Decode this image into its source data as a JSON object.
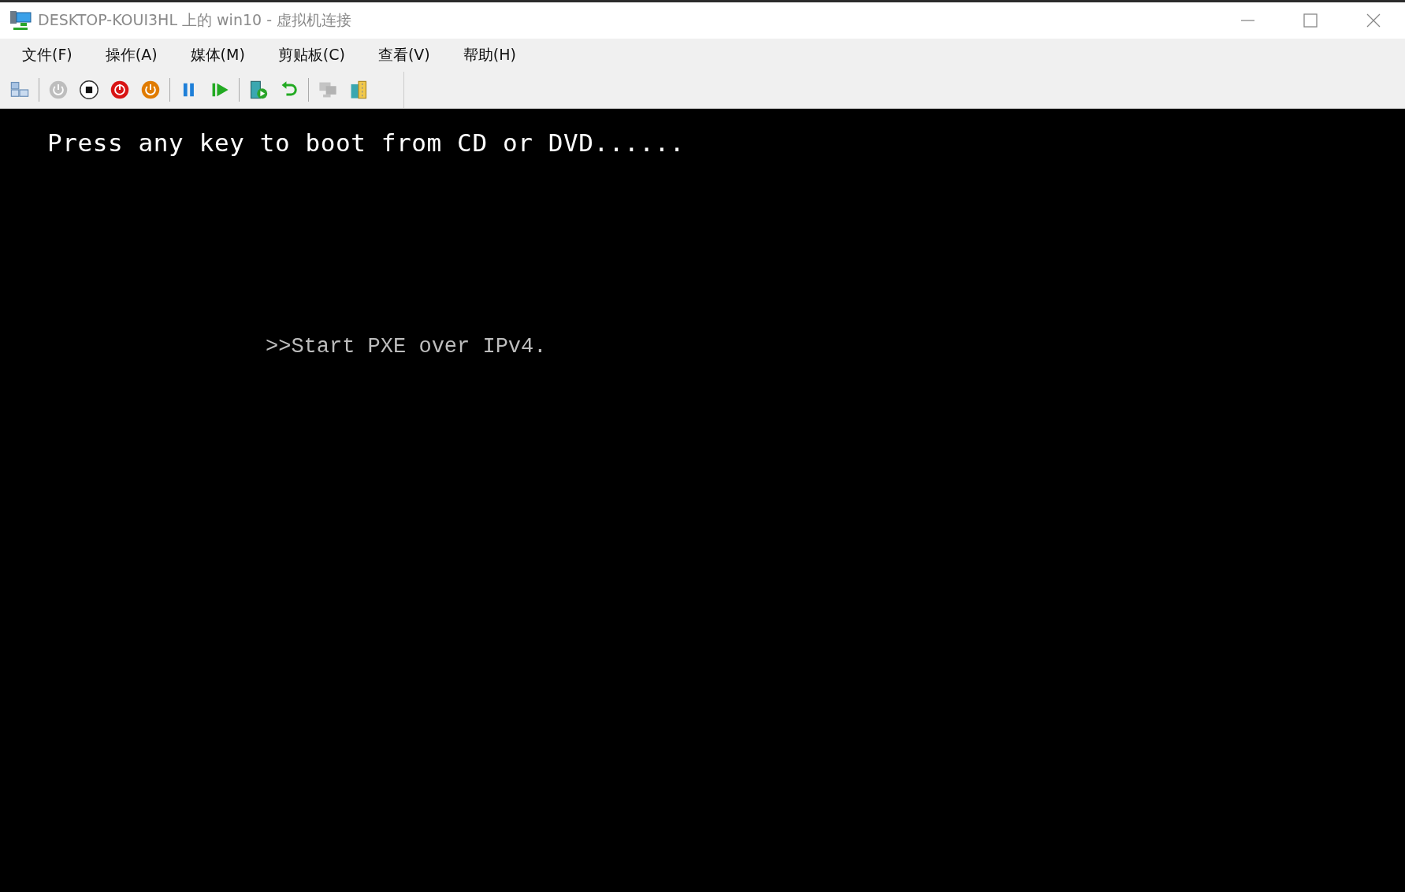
{
  "window": {
    "title": "DESKTOP-KOUI3HL 上的 win10 - 虚拟机连接"
  },
  "menu": [
    "文件(F)",
    "操作(A)",
    "媒体(M)",
    "剪贴板(C)",
    "查看(V)",
    "帮助(H)"
  ],
  "toolbar": [
    [
      {
        "kind": "ctrl-alt-del",
        "disabled": false
      }
    ],
    [
      {
        "kind": "start",
        "disabled": true
      },
      {
        "kind": "turn-off",
        "disabled": false
      },
      {
        "kind": "shut-down",
        "disabled": false
      },
      {
        "kind": "save",
        "disabled": false
      }
    ],
    [
      {
        "kind": "pause",
        "disabled": false
      },
      {
        "kind": "resume",
        "disabled": false
      }
    ],
    [
      {
        "kind": "checkpoint",
        "disabled": false
      },
      {
        "kind": "revert",
        "disabled": false
      }
    ],
    [
      {
        "kind": "enhanced-session",
        "disabled": true
      },
      {
        "kind": "share",
        "disabled": false
      }
    ]
  ],
  "console": {
    "lines": [
      {
        "kind": "prompt",
        "text": "Press any key to boot from CD or DVD......"
      },
      {
        "kind": "bios",
        "text": ">>Start PXE over IPv4."
      }
    ]
  }
}
